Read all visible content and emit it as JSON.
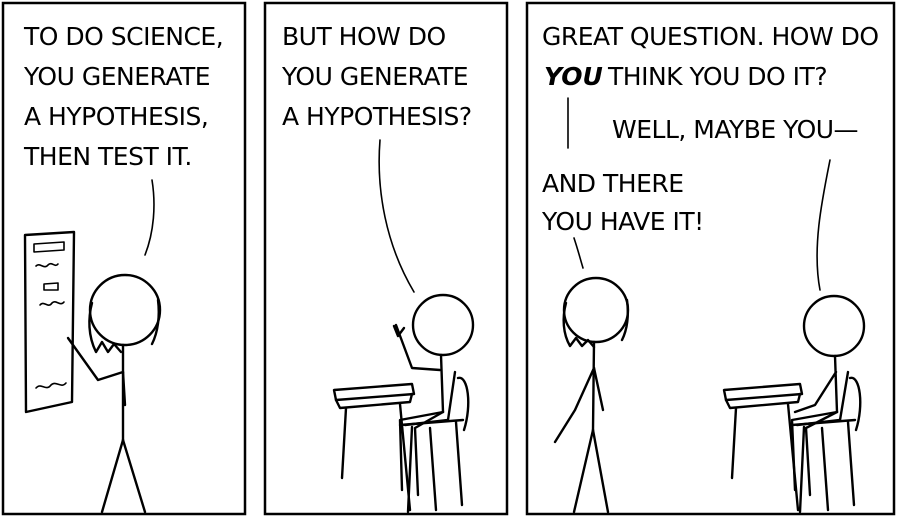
{
  "comic": {
    "panels": [
      {
        "speaker": "teacher",
        "dialog": [
          "TO DO SCIENCE,",
          "YOU GENERATE",
          "A HYPOTHESIS,",
          "THEN TEST IT."
        ]
      },
      {
        "speaker": "student",
        "dialog": [
          "BUT HOW DO",
          "YOU GENERATE",
          "A HYPOTHESIS?"
        ]
      },
      {
        "teacher_line_1": "GREAT QUESTION. HOW DO",
        "teacher_line_2_emphasis": "YOU",
        "teacher_line_2_rest": "THINK YOU DO IT?",
        "student_line": "WELL, MAYBE YOU—",
        "teacher_interrupt": [
          "AND THERE",
          "YOU HAVE IT!"
        ]
      }
    ]
  }
}
